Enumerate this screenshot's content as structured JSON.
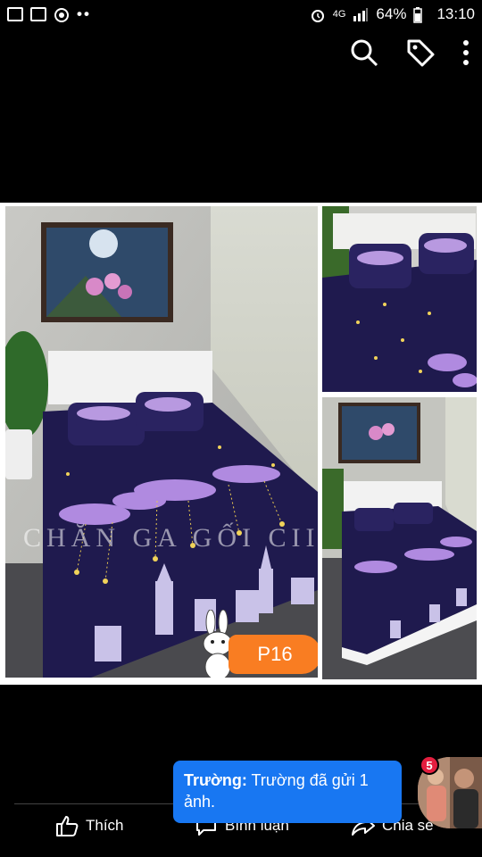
{
  "status_bar": {
    "network": "4G",
    "battery": "64%",
    "time": "13:10"
  },
  "photo": {
    "watermark": "CHĂN GA GỐI CIIC E",
    "price_tag": "P16"
  },
  "chat_head": {
    "sender": "Trường:",
    "message": " Trường đã gửi 1 ảnh.",
    "unread_count": "5"
  },
  "actions": {
    "like_label": "Thích",
    "comment_label": "Bình luận",
    "share_label": "Chia sẻ"
  },
  "colors": {
    "chat_blue": "#1877f2",
    "price_orange": "#f97d22",
    "badge_red": "#e41e3f"
  }
}
